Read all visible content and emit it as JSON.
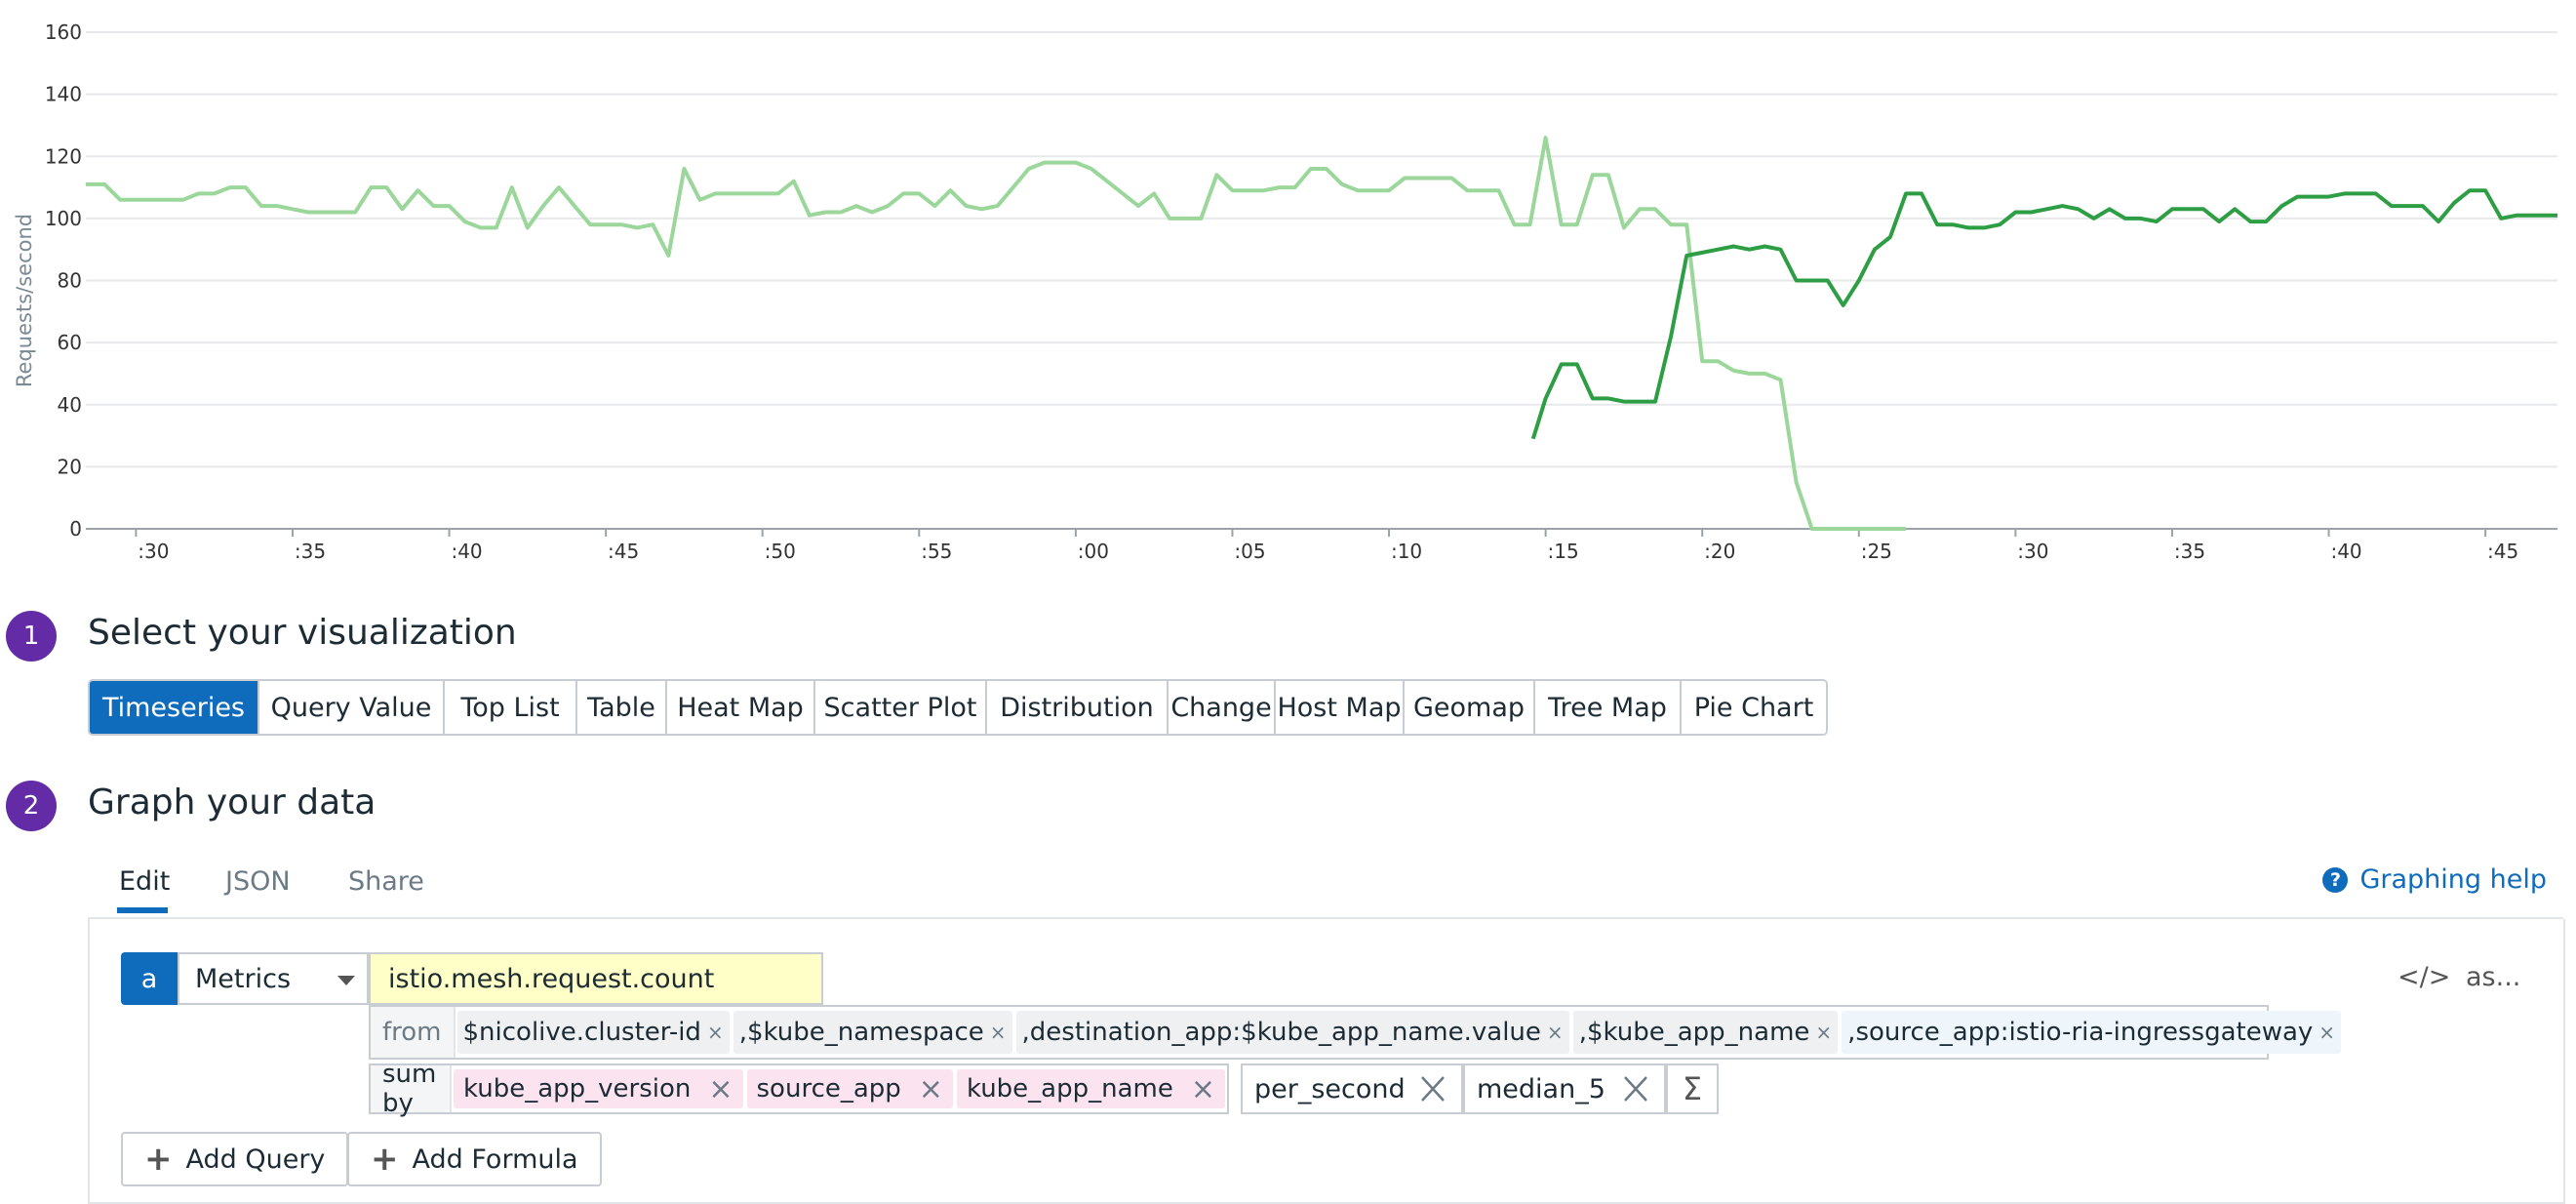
{
  "chart_data": {
    "type": "line",
    "ylabel": "Requests/second",
    "ylim": [
      0,
      160
    ],
    "yticks": [
      0,
      20,
      40,
      60,
      80,
      100,
      120,
      140,
      160
    ],
    "x_tick_labels": [
      ":30",
      ":35",
      ":40",
      ":45",
      ":50",
      ":55",
      ":00",
      ":05",
      ":10",
      ":15",
      ":20",
      ":25",
      ":30",
      ":35",
      ":40",
      ":45"
    ],
    "x_tick_minutes": [
      30,
      35,
      40,
      45,
      50,
      55,
      60,
      65,
      70,
      75,
      80,
      85,
      90,
      95,
      100,
      105
    ],
    "xlim_minutes": [
      28.4,
      107.3
    ],
    "grid": true,
    "series": [
      {
        "color": "#9bd69a",
        "points": [
          [
            28.4,
            111
          ],
          [
            29.0,
            111
          ],
          [
            29.5,
            106
          ],
          [
            30.0,
            106
          ],
          [
            30.5,
            106
          ],
          [
            31.0,
            106
          ],
          [
            31.5,
            106
          ],
          [
            32.0,
            108
          ],
          [
            32.5,
            108
          ],
          [
            33.0,
            110
          ],
          [
            33.5,
            110
          ],
          [
            34.0,
            104
          ],
          [
            34.5,
            104
          ],
          [
            35.0,
            103
          ],
          [
            35.5,
            102
          ],
          [
            36.0,
            102
          ],
          [
            36.5,
            102
          ],
          [
            37.0,
            102
          ],
          [
            37.5,
            110
          ],
          [
            38.0,
            110
          ],
          [
            38.5,
            103
          ],
          [
            39.0,
            109
          ],
          [
            39.5,
            104
          ],
          [
            40.0,
            104
          ],
          [
            40.5,
            99
          ],
          [
            41.0,
            97
          ],
          [
            41.5,
            97
          ],
          [
            42.0,
            110
          ],
          [
            42.5,
            97
          ],
          [
            43.0,
            104
          ],
          [
            43.5,
            110
          ],
          [
            44.0,
            104
          ],
          [
            44.5,
            98
          ],
          [
            45.0,
            98
          ],
          [
            45.5,
            98
          ],
          [
            46.0,
            97
          ],
          [
            46.5,
            98
          ],
          [
            47.0,
            88
          ],
          [
            47.5,
            116
          ],
          [
            48.0,
            106
          ],
          [
            48.5,
            108
          ],
          [
            49.0,
            108
          ],
          [
            49.5,
            108
          ],
          [
            50.0,
            108
          ],
          [
            50.5,
            108
          ],
          [
            51.0,
            112
          ],
          [
            51.5,
            101
          ],
          [
            52.0,
            102
          ],
          [
            52.5,
            102
          ],
          [
            53.0,
            104
          ],
          [
            53.5,
            102
          ],
          [
            54.0,
            104
          ],
          [
            54.5,
            108
          ],
          [
            55.0,
            108
          ],
          [
            55.5,
            104
          ],
          [
            56.0,
            109
          ],
          [
            56.5,
            104
          ],
          [
            57.0,
            103
          ],
          [
            57.5,
            104
          ],
          [
            58.0,
            110
          ],
          [
            58.5,
            116
          ],
          [
            59.0,
            118
          ],
          [
            59.5,
            118
          ],
          [
            60.0,
            118
          ],
          [
            60.5,
            116
          ],
          [
            61.0,
            112
          ],
          [
            61.5,
            108
          ],
          [
            62.0,
            104
          ],
          [
            62.5,
            108
          ],
          [
            63.0,
            100
          ],
          [
            63.5,
            100
          ],
          [
            64.0,
            100
          ],
          [
            64.5,
            114
          ],
          [
            65.0,
            109
          ],
          [
            65.5,
            109
          ],
          [
            66.0,
            109
          ],
          [
            66.5,
            110
          ],
          [
            67.0,
            110
          ],
          [
            67.5,
            116
          ],
          [
            68.0,
            116
          ],
          [
            68.5,
            111
          ],
          [
            69.0,
            109
          ],
          [
            69.5,
            109
          ],
          [
            70.0,
            109
          ],
          [
            70.5,
            113
          ],
          [
            71.0,
            113
          ],
          [
            71.5,
            113
          ],
          [
            72.0,
            113
          ],
          [
            72.5,
            109
          ],
          [
            73.0,
            109
          ],
          [
            73.5,
            109
          ],
          [
            74.0,
            98
          ],
          [
            74.5,
            98
          ],
          [
            75.0,
            126
          ],
          [
            75.5,
            98
          ],
          [
            76.0,
            98
          ],
          [
            76.5,
            114
          ],
          [
            77.0,
            114
          ],
          [
            77.5,
            97
          ],
          [
            78.0,
            103
          ],
          [
            78.5,
            103
          ],
          [
            79.0,
            98
          ],
          [
            79.5,
            98
          ],
          [
            80.0,
            54
          ],
          [
            80.5,
            54
          ],
          [
            81.0,
            51
          ],
          [
            81.5,
            50
          ],
          [
            82.0,
            50
          ],
          [
            82.5,
            48
          ],
          [
            83.0,
            15
          ],
          [
            83.5,
            0
          ],
          [
            84.0,
            0
          ],
          [
            84.5,
            0
          ],
          [
            85.0,
            0
          ],
          [
            85.5,
            0
          ],
          [
            86.0,
            0
          ],
          [
            86.5,
            0
          ]
        ]
      },
      {
        "color": "#2e9e45",
        "points": [
          [
            74.6,
            29
          ],
          [
            75.0,
            42
          ],
          [
            75.5,
            53
          ],
          [
            76.0,
            53
          ],
          [
            76.5,
            42
          ],
          [
            77.0,
            42
          ],
          [
            77.5,
            41
          ],
          [
            78.0,
            41
          ],
          [
            78.5,
            41
          ],
          [
            79.0,
            62
          ],
          [
            79.5,
            88
          ],
          [
            80.0,
            89
          ],
          [
            80.5,
            90
          ],
          [
            81.0,
            91
          ],
          [
            81.5,
            90
          ],
          [
            82.0,
            91
          ],
          [
            82.5,
            90
          ],
          [
            83.0,
            80
          ],
          [
            83.5,
            80
          ],
          [
            84.0,
            80
          ],
          [
            84.5,
            72
          ],
          [
            85.0,
            80
          ],
          [
            85.5,
            90
          ],
          [
            86.0,
            94
          ],
          [
            86.5,
            108
          ],
          [
            87.0,
            108
          ],
          [
            87.5,
            98
          ],
          [
            88.0,
            98
          ],
          [
            88.5,
            97
          ],
          [
            89.0,
            97
          ],
          [
            89.5,
            98
          ],
          [
            90.0,
            102
          ],
          [
            90.5,
            102
          ],
          [
            91.0,
            103
          ],
          [
            91.5,
            104
          ],
          [
            92.0,
            103
          ],
          [
            92.5,
            100
          ],
          [
            93.0,
            103
          ],
          [
            93.5,
            100
          ],
          [
            94.0,
            100
          ],
          [
            94.5,
            99
          ],
          [
            95.0,
            103
          ],
          [
            95.5,
            103
          ],
          [
            96.0,
            103
          ],
          [
            96.5,
            99
          ],
          [
            97.0,
            103
          ],
          [
            97.5,
            99
          ],
          [
            98.0,
            99
          ],
          [
            98.5,
            104
          ],
          [
            99.0,
            107
          ],
          [
            99.5,
            107
          ],
          [
            100.0,
            107
          ],
          [
            100.5,
            108
          ],
          [
            101.0,
            108
          ],
          [
            101.5,
            108
          ],
          [
            102.0,
            104
          ],
          [
            102.5,
            104
          ],
          [
            103.0,
            104
          ],
          [
            103.5,
            99
          ],
          [
            104.0,
            105
          ],
          [
            104.5,
            109
          ],
          [
            105.0,
            109
          ],
          [
            105.5,
            100
          ],
          [
            106.0,
            101
          ],
          [
            106.5,
            101
          ],
          [
            107.3,
            101
          ]
        ]
      }
    ]
  },
  "steps": [
    {
      "number": "1",
      "title": "Select your visualization"
    },
    {
      "number": "2",
      "title": "Graph your data"
    }
  ],
  "viz_types": [
    "Timeseries",
    "Query Value",
    "Top List",
    "Table",
    "Heat Map",
    "Scatter Plot",
    "Distribution",
    "Change",
    "Host Map",
    "Geomap",
    "Tree Map",
    "Pie Chart"
  ],
  "viz_selected": "Timeseries",
  "tabs": [
    "Edit",
    "JSON",
    "Share"
  ],
  "help_label": "Graphing help",
  "query": {
    "letter": "a",
    "source": "Metrics",
    "metric": "istio.mesh.request.count",
    "from_label": "from",
    "from_tags": [
      {
        "text": "$nicolive.cluster-id",
        "removable": true,
        "prefix": ""
      },
      {
        "text": "$kube_namespace",
        "removable": true,
        "prefix": ","
      },
      {
        "text": "destination_app:$kube_app_name.value",
        "removable": true,
        "prefix": ","
      },
      {
        "text": "$kube_app_name",
        "removable": true,
        "prefix": ","
      },
      {
        "text": "source_app:istio-ria-ingressgateway",
        "removable": true,
        "prefix": ","
      }
    ],
    "sum_label": "sum by",
    "sum_tags": [
      "kube_app_version",
      "source_app",
      "kube_app_name"
    ],
    "functions": [
      "per_second",
      "median_5"
    ],
    "sigma": "Σ",
    "code_toggle": "</>",
    "alias_label": "as..."
  },
  "buttons": {
    "add_query": "Add Query",
    "add_formula": "Add Formula"
  }
}
